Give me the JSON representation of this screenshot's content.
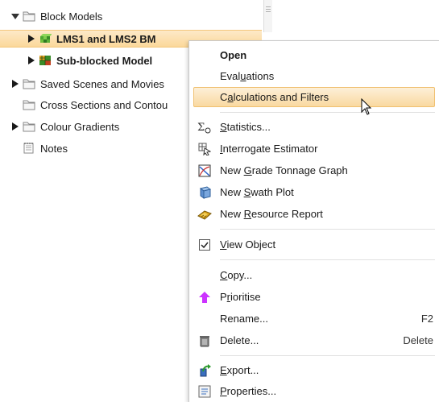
{
  "tree": {
    "items": [
      {
        "label": "Block Models",
        "expand": "expanded",
        "icon": "folder-icon"
      },
      {
        "label": "LMS1 and LMS2 BM",
        "expand": "collapsed",
        "icon": "block-model-icon",
        "selected": true
      },
      {
        "label": "Sub-blocked Model",
        "expand": "collapsed",
        "icon": "sub-blocked-model-icon"
      },
      {
        "label": "Saved Scenes and Movies",
        "expand": "collapsed",
        "icon": "folder-icon"
      },
      {
        "label": "Cross Sections and Contou",
        "expand": "none",
        "icon": "folder-icon"
      },
      {
        "label": "Colour Gradients",
        "expand": "collapsed",
        "icon": "folder-icon"
      },
      {
        "label": "Notes",
        "expand": "none",
        "icon": "notes-icon"
      }
    ]
  },
  "menu": {
    "open": "Open",
    "evaluations": "Evaluations",
    "calculations": "Calculations and Filters",
    "statistics": "Statistics...",
    "interrogate": "Interrogate Estimator",
    "grade_tonnage": "New Grade Tonnage Graph",
    "swath": "New Swath Plot",
    "resource_report": "New Resource Report",
    "view_object": "View Object",
    "copy": "Copy...",
    "prioritise": "Prioritise",
    "rename": "Rename...",
    "rename_shortcut": "F2",
    "delete": "Delete...",
    "delete_shortcut": "Delete",
    "export": "Export...",
    "properties": "Properties..."
  },
  "colors": {
    "selection": "#fbd89a",
    "hover": "#f9d9a0",
    "prioritise_arrow": "#cc33ff"
  }
}
